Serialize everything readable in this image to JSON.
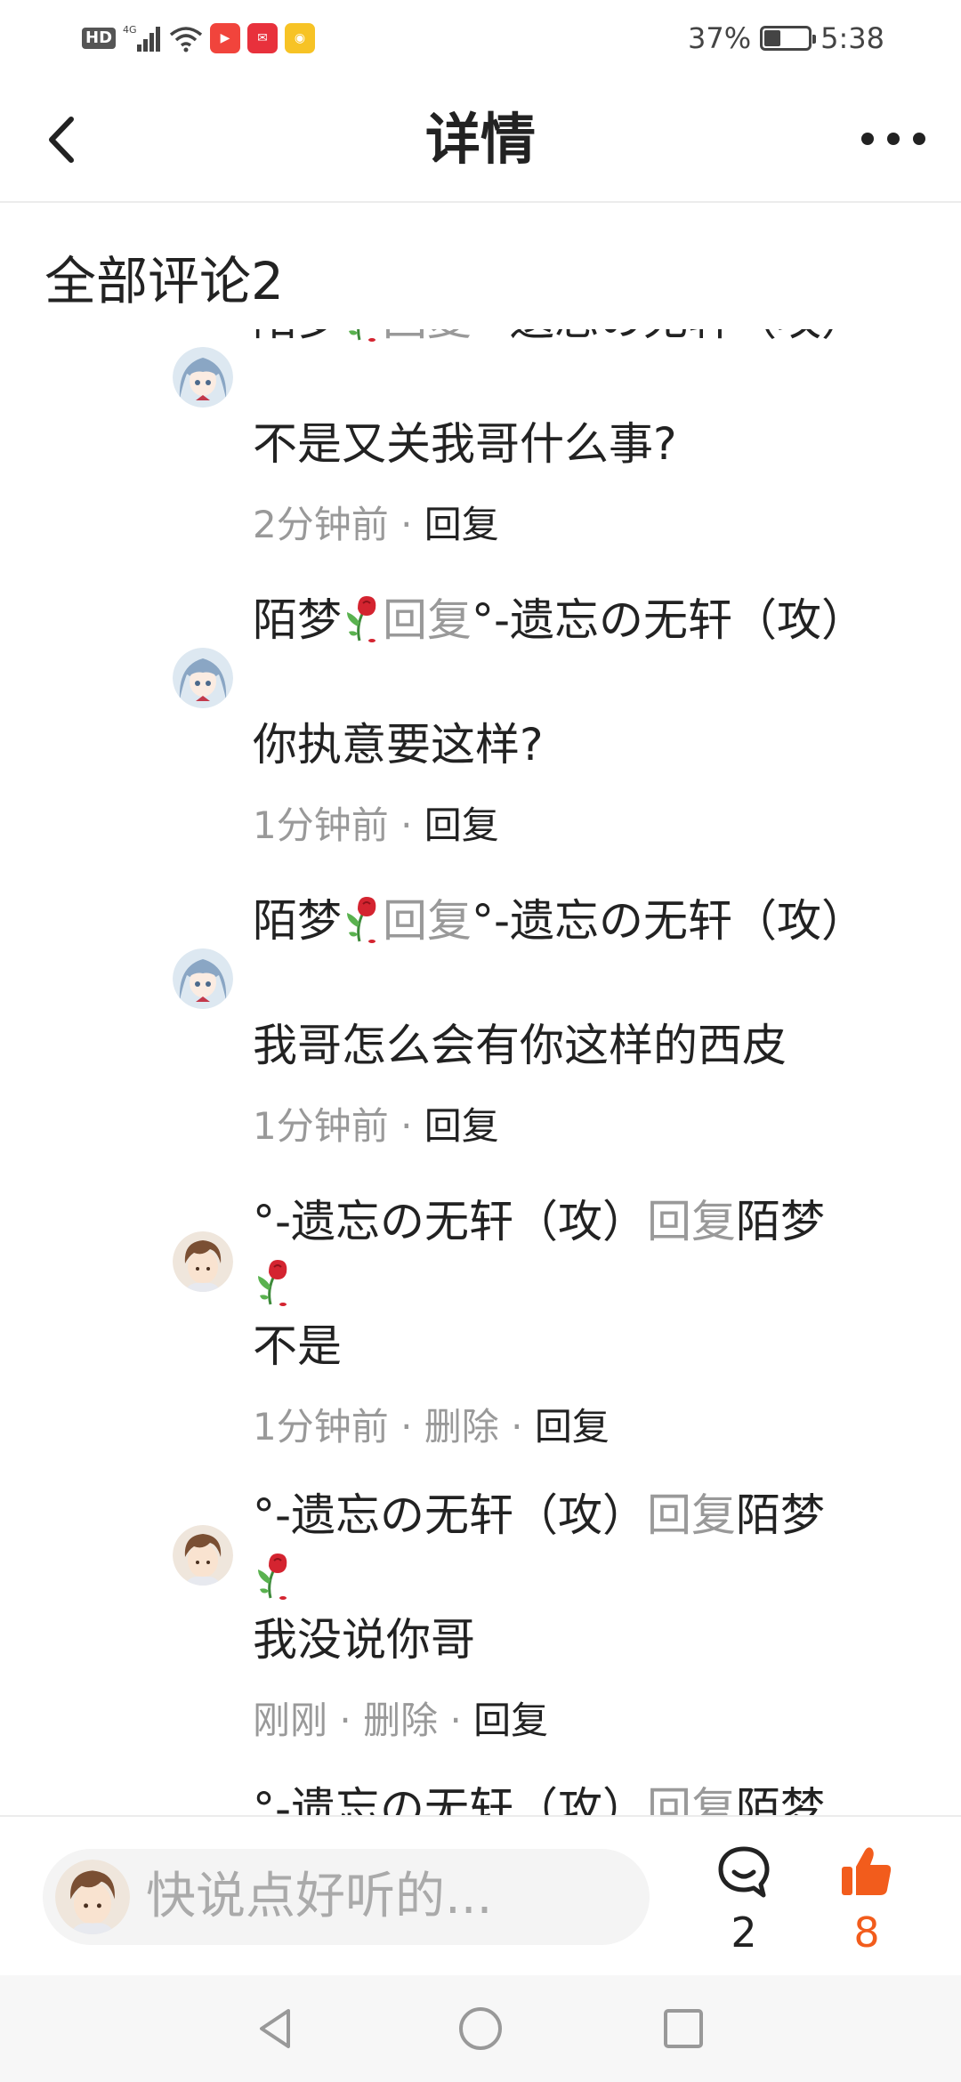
{
  "status_bar": {
    "hd": "HD",
    "network": "4G",
    "battery_text": "37%",
    "battery_level": 0.37,
    "time": "5:38"
  },
  "header": {
    "title": "详情"
  },
  "comments_header": "全部评论2",
  "replies": [
    {
      "author": "陌梦",
      "reply_word": "回复",
      "target": "°-遗忘の无轩（攻）",
      "text": "不是又关我哥什么事?",
      "time": "2分钟前",
      "delete": "",
      "reply_action": "回复",
      "avatar": "girl-avatar"
    },
    {
      "author": "陌梦",
      "reply_word": "回复",
      "target": "°-遗忘の无轩（攻）",
      "text": "你执意要这样?",
      "time": "1分钟前",
      "delete": "",
      "reply_action": "回复",
      "avatar": "girl-avatar"
    },
    {
      "author": "陌梦",
      "reply_word": "回复",
      "target": "°-遗忘の无轩（攻）",
      "text": "我哥怎么会有你这样的西皮",
      "time": "1分钟前",
      "delete": "",
      "reply_action": "回复",
      "avatar": "girl-avatar"
    },
    {
      "author": "°-遗忘の无轩（攻）",
      "reply_word": "回复",
      "target": "陌梦",
      "text": "不是",
      "time": "1分钟前",
      "delete": "删除",
      "reply_action": "回复",
      "avatar": "boy-avatar"
    },
    {
      "author": "°-遗忘の无轩（攻）",
      "reply_word": "回复",
      "target": "陌梦",
      "text": "我没说你哥",
      "time": "刚刚",
      "delete": "删除",
      "reply_action": "回复",
      "avatar": "boy-avatar"
    },
    {
      "author": "°-遗忘の无轩（攻）",
      "reply_word": "回复",
      "target": "陌梦",
      "text": "",
      "time": "",
      "delete": "",
      "reply_action": "",
      "avatar": "boy-avatar"
    }
  ],
  "bottom_bar": {
    "input_placeholder": "快说点好听的...",
    "comment_count": "2",
    "like_count": "8"
  },
  "colors": {
    "like_orange": "#f25c1c",
    "muted_gray": "#999999",
    "text": "#222222"
  }
}
